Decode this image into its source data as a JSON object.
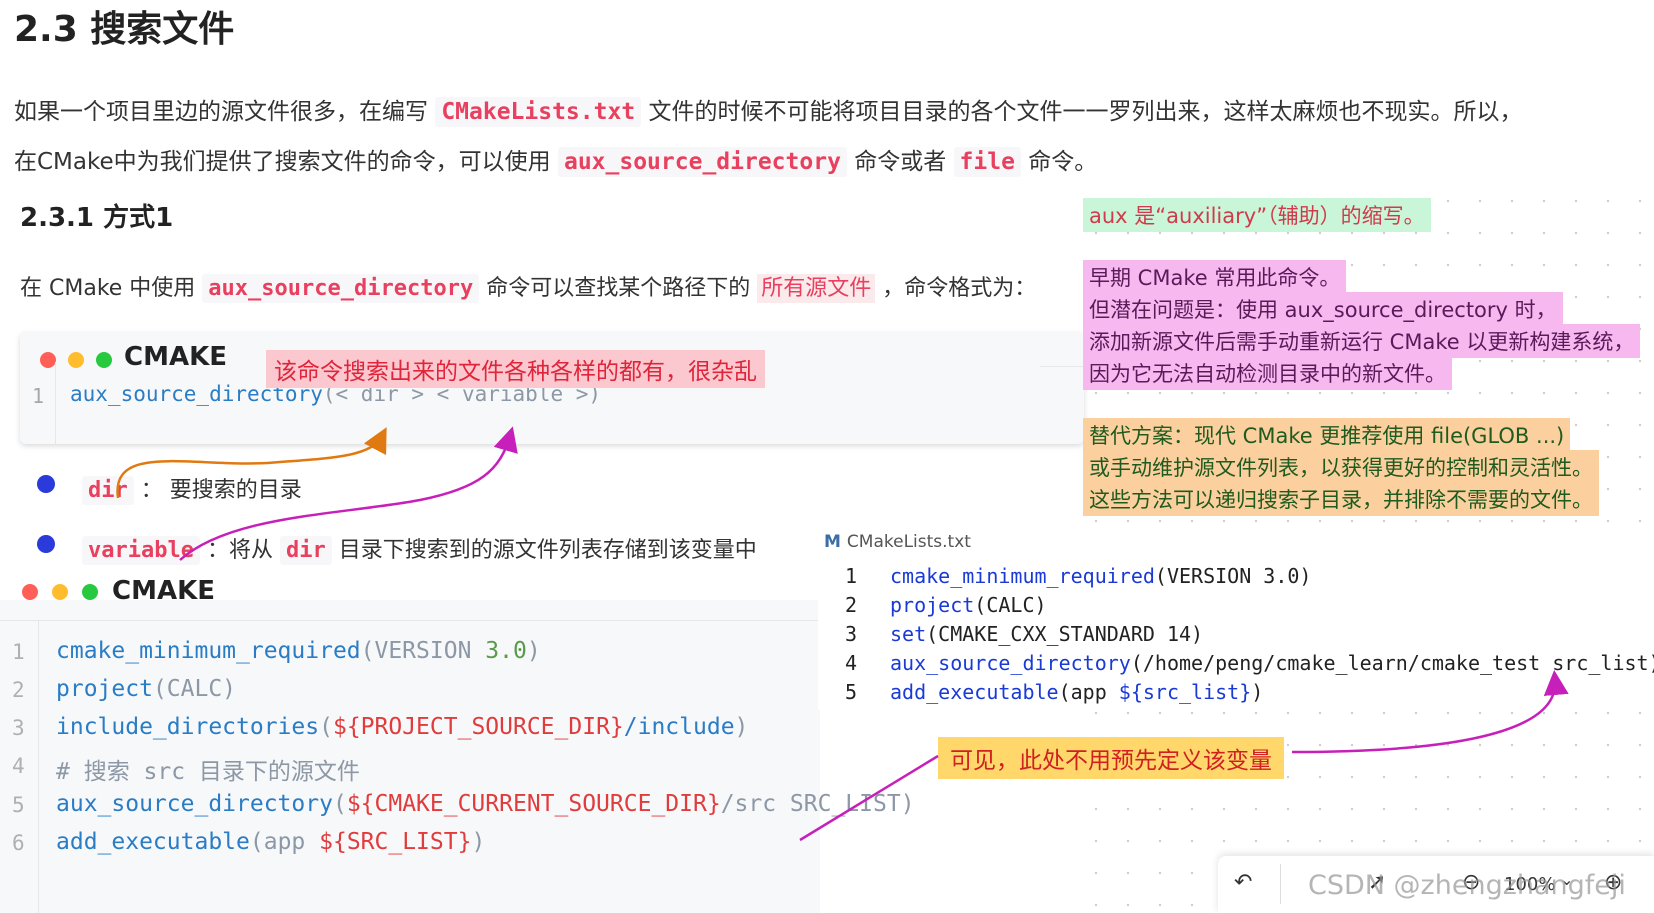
{
  "heading": "2.3 搜索文件",
  "intro": {
    "line1_a": "如果一个项目里边的源文件很多，在编写 ",
    "line1_code": "CMakeLists.txt",
    "line1_b": " 文件的时候不可能将项目目录的各个文件一一罗列出来，这样太麻烦也不现实。所以，",
    "line2_a": "在CMake中为我们提供了搜索文件的命令，可以使用 ",
    "line2_code1": "aux_source_directory",
    "line2_b": " 命令或者 ",
    "line2_code2": "file",
    "line2_c": " 命令。"
  },
  "section": {
    "title": "2.3.1 方式1",
    "desc_a": "在 CMake 中使用 ",
    "desc_code": "aux_source_directory",
    "desc_b": " 命令可以查找某个路径下的 ",
    "desc_hl": "所有源文件",
    "desc_c": " ，命令格式为："
  },
  "codeblock1": {
    "lang": "CMAKE",
    "line_no": "1",
    "fn": "aux_source_directory",
    "args": "(< dir > < variable >)"
  },
  "note_pink": "该命令搜索出来的文件各种各样的都有，很杂乱",
  "bullets": [
    {
      "code": "dir",
      "text": " ： 要搜索的目录"
    },
    {
      "code": "variable",
      "text": " ：将从 ",
      "code2": "dir",
      "text2": " 目录下搜索到的源文件列表存储到该变量中"
    }
  ],
  "codeblock2": {
    "lang": "CMAKE",
    "lines": [
      {
        "n": "1",
        "fn": "cmake_minimum_required",
        "rest": "(VERSION 3.0)"
      },
      {
        "n": "2",
        "fn": "project",
        "rest": "(CALC)"
      },
      {
        "n": "3",
        "fn": "include_directories",
        "rest": "(${PROJECT_SOURCE_DIR}/include)"
      },
      {
        "n": "4",
        "fn": "",
        "rest": "# 搜索 src 目录下的源文件"
      },
      {
        "n": "5",
        "fn": "aux_source_directory",
        "rest": "(${CMAKE_CURRENT_SOURCE_DIR}/src SRC_LIST)"
      },
      {
        "n": "6",
        "fn": "add_executable",
        "rest": "(app  ${SRC_LIST})"
      }
    ]
  },
  "cmakefile": {
    "filename": "CMakeLists.txt",
    "icon": "M",
    "lines": [
      {
        "n": "1",
        "fn": "cmake_minimum_required",
        "rest": "(VERSION 3.0)"
      },
      {
        "n": "2",
        "fn": "project",
        "rest": "(CALC)"
      },
      {
        "n": "3",
        "fn": "set",
        "rest": "(CMAKE_CXX_STANDARD 14)"
      },
      {
        "n": "4",
        "fn": "aux_source_directory",
        "rest": "(/home/peng/cmake_learn/cmake_test src_list)"
      },
      {
        "n": "5",
        "fn": "add_executable",
        "rest": "(app ${src_list})"
      }
    ]
  },
  "side_notes": {
    "green": "aux 是“auxiliary”（辅助）的缩写。",
    "pink": [
      "早期 CMake 常用此命令。",
      "但潜在问题是：使用 aux_source_directory 时，",
      "添加新源文件后需手动重新运行 CMake 以更新构建系统，",
      "因为它无法自动检测目录中的新文件。"
    ],
    "orange": [
      "替代方案：现代 CMake 更推荐使用 file(GLOB ...)",
      "或手动维护源文件列表，以获得更好的控制和灵活性。",
      "这些方法可以递归搜索子目录，并排除不需要的文件。"
    ]
  },
  "note_yellow": "可见，此处不用预先定义该变量",
  "toolbar": {
    "zoom": "100%",
    "zoom_arrow": "⌄"
  },
  "watermark": "CSDN @zhengzhangfeji",
  "colors": {
    "accent_red": "#e8405e",
    "dot_red": "#ff5f56",
    "dot_yellow": "#ffbd2e",
    "dot_green": "#27c93f"
  }
}
